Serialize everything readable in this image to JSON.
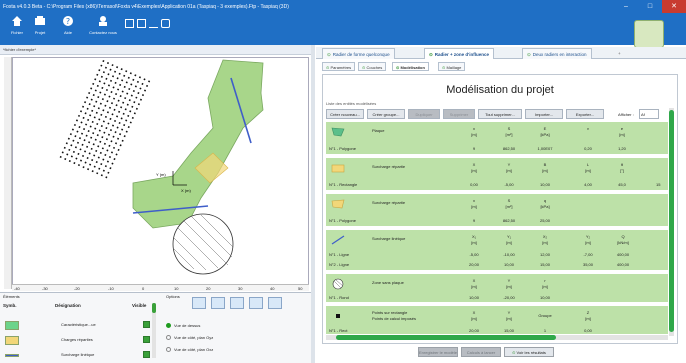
{
  "window": {
    "title": "Foxta v4.0.3 Beta - C:\\Program Files (x86)\\Terrasol\\Foxta v4\\Exemples\\Application 01a (Taspiaq - 3 exemples).Ftp - Taspiaq (3D)",
    "minimize": "–",
    "maximize": "□",
    "close": "✕"
  },
  "toolbar": {
    "items": [
      {
        "label": "Fichier",
        "icon": "home-icon"
      },
      {
        "label": "Projet",
        "icon": "project-icon"
      },
      {
        "label": "Aide",
        "icon": "help-icon"
      },
      {
        "label": "Contactez nous",
        "icon": "contact-icon"
      }
    ]
  },
  "left_panel": {
    "file_label": "*fichier d'exemple*",
    "y_axis_label": "Y (m)",
    "x_axis_label": "X (m)",
    "ruler_ticks": [
      "-40",
      "-30",
      "-20",
      "-10",
      "0",
      "10",
      "20",
      "30",
      "40",
      "50"
    ]
  },
  "elements_panel": {
    "title": "Éléments",
    "col_symbol": "Symb.",
    "col_designation": "Désignation",
    "col_visible": "Visible",
    "rows": [
      {
        "label": "Caractéristique...ue",
        "color": "#6cd48a"
      },
      {
        "label": "Charges réparties",
        "color": "#f2d779"
      },
      {
        "label": "Surcharge linéique",
        "color": "#3f5ec9"
      }
    ]
  },
  "options_panel": {
    "title": "Options",
    "views": [
      {
        "label": "Vue de dessus",
        "selected": true
      },
      {
        "label": "Vue de côté, plan Oyz",
        "selected": false
      },
      {
        "label": "Vue de côté, plan Oxz",
        "selected": false
      }
    ]
  },
  "tabs": [
    {
      "label": "Radier de forme quelconque",
      "active": false
    },
    {
      "label": "Radier + zone d'influence",
      "active": true
    },
    {
      "label": "Deux radiers en interaction",
      "active": false
    }
  ],
  "add_tab": "+",
  "subtabs": [
    {
      "label": "Paramètres",
      "active": false
    },
    {
      "label": "Couches",
      "active": false
    },
    {
      "label": "Modélisation",
      "active": true
    },
    {
      "label": "Maillage",
      "active": false
    }
  ],
  "main": {
    "title": "Modélisation du projet",
    "list_label": "Liste des entités modélisées",
    "buttons": [
      {
        "label": "Créer nouveau...",
        "disabled": false
      },
      {
        "label": "Créer groupe...",
        "disabled": false
      },
      {
        "label": "Dupliquer",
        "disabled": true
      },
      {
        "label": "Supprimer",
        "disabled": true
      },
      {
        "label": "Tout supprimer...",
        "disabled": false
      },
      {
        "label": "Importer...",
        "disabled": false
      },
      {
        "label": "Exporter...",
        "disabled": false
      }
    ],
    "afficher_label": "Afficher :",
    "afficher_value": "Af"
  },
  "table_rows": [
    {
      "name": "Plaque",
      "id": "N°1 - Polygone",
      "icon": "plate-icon",
      "headers": [
        [
          "x",
          "[m]"
        ],
        [
          "S",
          "[m²]"
        ],
        [
          "E",
          "[kPa]"
        ],
        [
          "ν",
          ""
        ],
        [
          "e",
          "[m]"
        ]
      ],
      "values": [
        "9",
        "862,50",
        "1,00E07",
        "0,20",
        "1,20"
      ]
    },
    {
      "name": "Surcharge répartie",
      "id": "N°1 - Rectangle",
      "icon": "rect-load-icon",
      "headers": [
        [
          "X",
          "[m]"
        ],
        [
          "Y",
          "[m]"
        ],
        [
          "B",
          "[m]"
        ],
        [
          "L",
          "[m]"
        ],
        [
          "θ",
          "[°]"
        ]
      ],
      "values": [
        "0,00",
        "-5,00",
        "10,00",
        "4,00",
        "45,0",
        "15"
      ]
    },
    {
      "name": "Surcharge répartie",
      "id": "N°1 - Polygone",
      "icon": "poly-load-icon",
      "headers": [
        [
          "x",
          "[m]"
        ],
        [
          "S",
          "[m²]"
        ],
        [
          "q",
          "[kPa]"
        ]
      ],
      "values": [
        "9",
        "862,50",
        "25,00"
      ]
    },
    {
      "name": "Surcharge linéique",
      "id": "N°1 - Ligne",
      "id2": "N°2 - Ligne",
      "icon": "line-load-icon",
      "headers": [
        [
          "X₁",
          "[m]"
        ],
        [
          "Y₁",
          "[m]"
        ],
        [
          "X₂",
          "[m]"
        ],
        [
          "Y₂",
          "[m]"
        ],
        [
          "Q",
          "[kN/m]"
        ]
      ],
      "values": [
        "-5,00",
        "-10,00",
        "12,00",
        "-7,00",
        "400,00"
      ],
      "values2": [
        "20,00",
        "10,00",
        "15,00",
        "35,00",
        "400,00"
      ]
    },
    {
      "name": "Zone sans plaque",
      "id": "N°1 - Rond",
      "icon": "no-plate-icon",
      "headers": [
        [
          "X",
          "[m]"
        ],
        [
          "Y",
          "[m]"
        ],
        [
          "r",
          "[m]"
        ]
      ],
      "values": [
        "10,00",
        "-20,00",
        "10,00"
      ]
    },
    {
      "name": "Points sur rectangle",
      "name2": "Points de calcul imposés",
      "id": "N°1 - Rect",
      "icon": "points-icon",
      "headers": [
        [
          "X",
          "[m]"
        ],
        [
          "Y",
          "[m]"
        ],
        [
          "Groupe",
          ""
        ],
        [
          "Z",
          "[m]"
        ]
      ],
      "values": [
        "20,00",
        "15,00",
        "1",
        "0,00"
      ]
    }
  ],
  "footer": {
    "btn1": "Enregistrer le modèle",
    "btn2": "Calculs à lancer",
    "btn3": "Voir les résultats"
  }
}
